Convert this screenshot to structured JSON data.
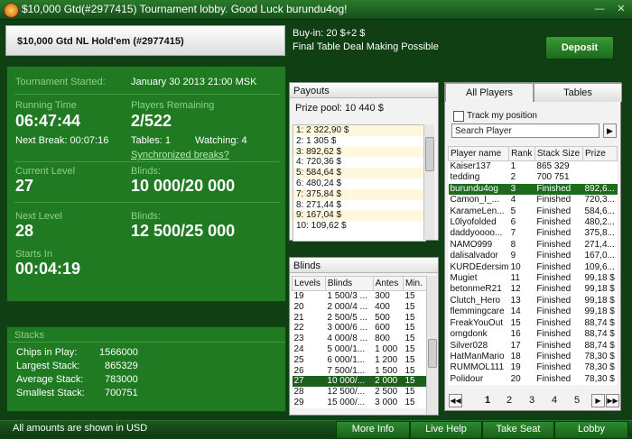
{
  "window": {
    "title": "$10,000 Gtd(#2977415) Tournament lobby. Good Luck burundu4og!"
  },
  "header": {
    "tournament_name": "$10,000 Gtd NL Hold'em (#2977415)",
    "buy_in": "Buy-in: 20 $+2 $",
    "final_deal": "Final Table Deal Making Possible",
    "deposit_label": "Deposit"
  },
  "info": {
    "started_label": "Tournament Started:",
    "started_value": "January 30 2013  21:00 MSK",
    "running_label": "Running Time",
    "running_value": "06:47:44",
    "remaining_label": "Players Remaining",
    "remaining_value": "2/522",
    "next_break": "Next Break: 00:07:16",
    "tables": "Tables: 1",
    "watching": "Watching: 4",
    "sync_breaks": "Synchronized breaks?",
    "current_level_label": "Current Level",
    "current_level_value": "27",
    "blinds_label": "Blinds:",
    "blinds_value": "10 000/20 000",
    "next_level_label": "Next Level",
    "next_level_value": "28",
    "next_blinds_label": "Blinds:",
    "next_blinds_value": "12 500/25 000",
    "starts_in_label": "Starts In",
    "starts_in_value": "00:04:19"
  },
  "stacks": {
    "title": "Stacks",
    "rows": [
      {
        "label": "Chips in Play:",
        "value": "1566000"
      },
      {
        "label": "Largest Stack:",
        "value": "865329"
      },
      {
        "label": "Average Stack:",
        "value": "783000"
      },
      {
        "label": "Smallest Stack:",
        "value": "700751"
      }
    ]
  },
  "payouts": {
    "title": "Payouts",
    "prize_pool": "Prize pool: 10 440 $",
    "rows": [
      "1: 2 322,90 $",
      "2: 1 305 $",
      "3: 892,62 $",
      "4: 720,36 $",
      "5: 584,64 $",
      "6: 480,24 $",
      "7: 375,84 $",
      "8: 271,44 $",
      "9: 167,04 $",
      "10: 109,62 $"
    ]
  },
  "blinds": {
    "title": "Blinds",
    "headers": [
      "Levels",
      "Blinds",
      "Antes",
      "Min."
    ],
    "rows": [
      [
        "19",
        "1 500/3 ...",
        "300",
        "15"
      ],
      [
        "20",
        "2 000/4 ...",
        "400",
        "15"
      ],
      [
        "21",
        "2 500/5 ...",
        "500",
        "15"
      ],
      [
        "22",
        "3 000/6 ...",
        "600",
        "15"
      ],
      [
        "23",
        "4 000/8 ...",
        "800",
        "15"
      ],
      [
        "24",
        "5 000/1...",
        "1 000",
        "15"
      ],
      [
        "25",
        "6 000/1...",
        "1 200",
        "15"
      ],
      [
        "26",
        "7 500/1...",
        "1 500",
        "15"
      ],
      [
        "27",
        "10 000/...",
        "2 000",
        "15"
      ],
      [
        "28",
        "12 500/...",
        "2 500",
        "15"
      ],
      [
        "29",
        "15 000/...",
        "3 000",
        "15"
      ]
    ],
    "selected_index": 8
  },
  "players": {
    "tab_all": "All Players",
    "tab_tables": "Tables",
    "track_label": "Track my position",
    "search_placeholder": "Search Player",
    "headers": [
      "Player name",
      "Rank",
      "Stack Size",
      "Prize"
    ],
    "rows": [
      [
        "Kaiser137",
        "1",
        "865 329",
        ""
      ],
      [
        "tedding",
        "2",
        "700 751",
        ""
      ],
      [
        "burundu4og",
        "3",
        "Finished",
        "892,6..."
      ],
      [
        "Camon_I_...",
        "4",
        "Finished",
        "720,3..."
      ],
      [
        "KarameLen...",
        "5",
        "Finished",
        "584,6..."
      ],
      [
        "L0lyofolded",
        "6",
        "Finished",
        "480,2..."
      ],
      [
        "daddyoooo...",
        "7",
        "Finished",
        "375,8..."
      ],
      [
        "NAMO999",
        "8",
        "Finished",
        "271,4..."
      ],
      [
        "dalisalvador",
        "9",
        "Finished",
        "167,0..."
      ],
      [
        "KURDEdersim",
        "10",
        "Finished",
        "109,6..."
      ],
      [
        "Mugiet",
        "11",
        "Finished",
        "99,18 $"
      ],
      [
        "betonmeR21",
        "12",
        "Finished",
        "99,18 $"
      ],
      [
        "Clutch_Hero",
        "13",
        "Finished",
        "99,18 $"
      ],
      [
        "flemmingcare",
        "14",
        "Finished",
        "99,18 $"
      ],
      [
        "FreakYouOut",
        "15",
        "Finished",
        "88,74 $"
      ],
      [
        "omgdonk",
        "16",
        "Finished",
        "88,74 $"
      ],
      [
        "Silver028",
        "17",
        "Finished",
        "88,74 $"
      ],
      [
        "HatManMario",
        "18",
        "Finished",
        "78,30 $"
      ],
      [
        "RUMMOL111",
        "19",
        "Finished",
        "78,30 $"
      ],
      [
        "Polidour",
        "20",
        "Finished",
        "78,30 $"
      ]
    ],
    "highlight_index": 2,
    "pages": [
      "1",
      "2",
      "3",
      "4",
      "5"
    ]
  },
  "footer": {
    "note": "All amounts are shown in USD",
    "more_info": "More Info",
    "live_help": "Live Help",
    "take_seat": "Take Seat",
    "lobby": "Lobby"
  }
}
